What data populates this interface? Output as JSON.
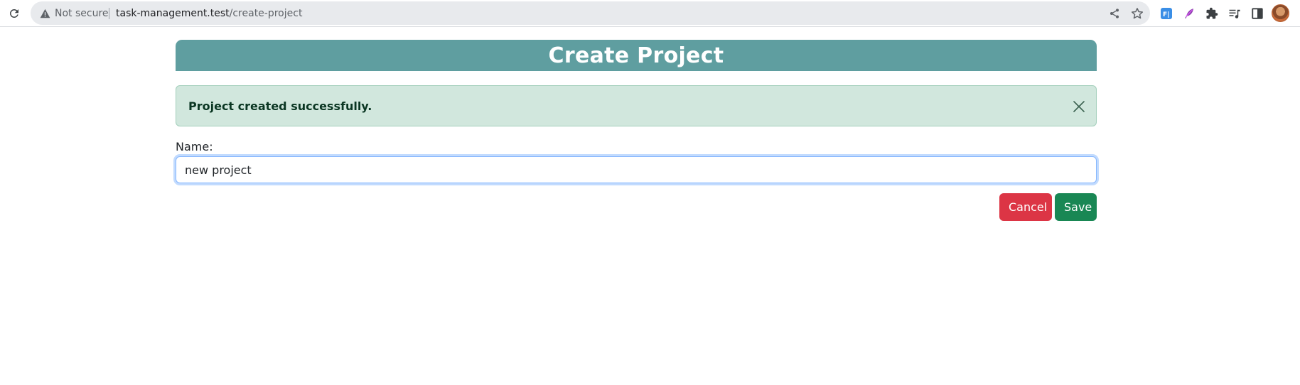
{
  "browser": {
    "security_label": "Not secure",
    "url_domain": "task-management.test",
    "url_path": "/create-project"
  },
  "page": {
    "title": "Create Project"
  },
  "alert": {
    "message": "Project created successfully."
  },
  "form": {
    "name_label": "Name:",
    "name_value": "new project"
  },
  "actions": {
    "cancel_label": "Cancel",
    "save_label": "Save"
  },
  "colors": {
    "header_bg": "#5f9ea0",
    "alert_bg": "#d1e7dd",
    "cancel_bg": "#dc3545",
    "save_bg": "#198754"
  },
  "icons": {
    "reload": "reload-icon",
    "warning": "warning-icon",
    "share": "share-icon",
    "bookmark": "star-icon",
    "extensions": [
      "formfill-extension-icon",
      "feather-extension-icon",
      "puzzle-extensions-icon",
      "media-control-icon",
      "side-panel-icon"
    ],
    "alert_close": "close-icon"
  }
}
